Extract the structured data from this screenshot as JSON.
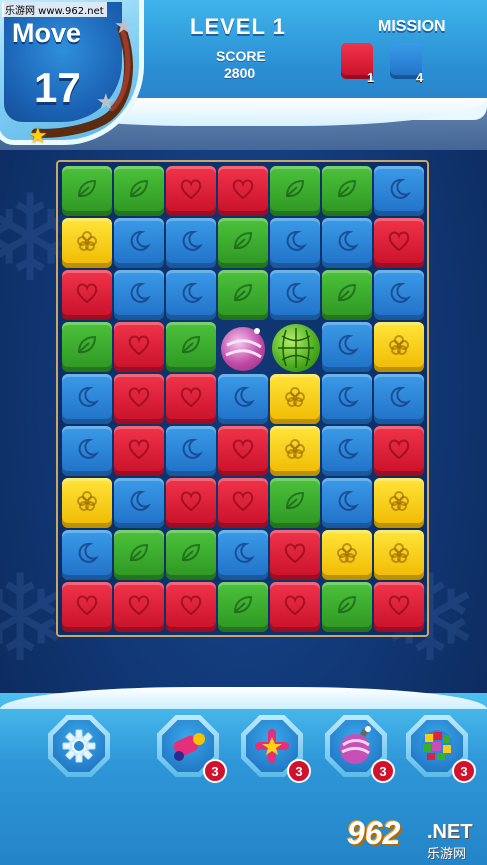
{
  "watermark": "乐游网 www.962.net",
  "hud": {
    "move_label": "Move",
    "move_count": "17",
    "level": "LEVEL 1",
    "score_label": "SCORE",
    "score_value": "2800",
    "mission_label": "MISSION",
    "mission": [
      {
        "color": "red",
        "count": "1"
      },
      {
        "color": "blue",
        "count": "4"
      }
    ]
  },
  "colors": {
    "red": "#e0213a",
    "green": "#3aad2c",
    "blue": "#2b87d8",
    "yellow": "#f7cc17"
  },
  "board": {
    "columns": 7,
    "rows": 9,
    "cells": [
      [
        "green",
        "green",
        "red",
        "red",
        "green",
        "green",
        "blue"
      ],
      [
        "yellow",
        "blue",
        "blue",
        "green",
        "blue",
        "blue",
        "red"
      ],
      [
        "red",
        "blue",
        "blue",
        "green",
        "blue",
        "green",
        "blue"
      ],
      [
        "green",
        "red",
        "green",
        "bomb",
        "disco",
        "blue",
        "yellow"
      ],
      [
        "blue",
        "red",
        "red",
        "blue",
        "yellow",
        "blue",
        "blue"
      ],
      [
        "blue",
        "red",
        "blue",
        "red",
        "yellow",
        "blue",
        "red"
      ],
      [
        "yellow",
        "blue",
        "red",
        "red",
        "green",
        "blue",
        "yellow"
      ],
      [
        "blue",
        "green",
        "green",
        "blue",
        "red",
        "yellow",
        "yellow"
      ],
      [
        "red",
        "red",
        "red",
        "green",
        "red",
        "green",
        "red"
      ]
    ],
    "symbols": {
      "red": "heart-icon",
      "green": "leaf-icon",
      "blue": "moon-icon",
      "yellow": "flower-icon"
    }
  },
  "boosters": [
    {
      "name": "settings",
      "icon": "gear-icon",
      "count": ""
    },
    {
      "name": "cannon",
      "icon": "cannon-icon",
      "count": "3"
    },
    {
      "name": "cross-rocket",
      "icon": "cross-rocket-icon",
      "count": "3"
    },
    {
      "name": "bomb",
      "icon": "bomb-icon",
      "count": "3"
    },
    {
      "name": "disco-ball",
      "icon": "disco-ball-icon",
      "count": "3"
    }
  ],
  "corner_logo": {
    "number": "962",
    "suffix": ".NET",
    "subtitle": "乐游网"
  }
}
